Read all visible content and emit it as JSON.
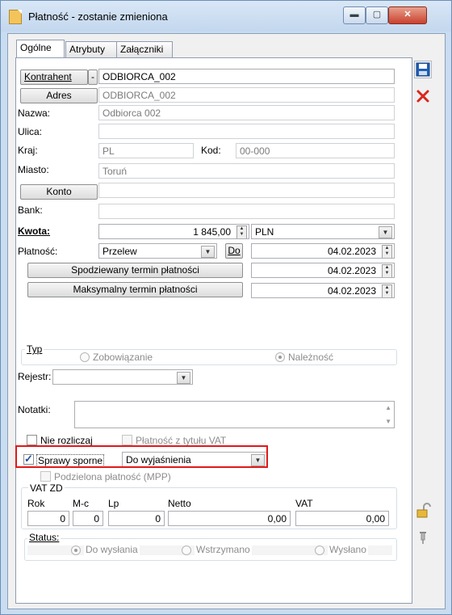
{
  "window": {
    "title": "Płatność - zostanie zmieniona"
  },
  "tabs": [
    "Ogólne",
    "Atrybuty",
    "Załączniki"
  ],
  "form": {
    "kontrahent_button": "Kontrahent",
    "kontrahent_value": "ODBIORCA_002",
    "adres_button": "Adres",
    "adres_value": "ODBIORCA_002",
    "nazwa_label": "Nazwa:",
    "nazwa_value": "Odbiorca 002",
    "ulica_label": "Ulica:",
    "ulica_value": "",
    "kraj_label": "Kraj:",
    "kraj_value": "PL",
    "kod_label": "Kod:",
    "kod_value": "00-000",
    "miasto_label": "Miasto:",
    "miasto_value": "Toruń",
    "konto_button": "Konto",
    "konto_value": "",
    "bank_label": "Bank:",
    "bank_value": "",
    "kwota_label": "Kwota:",
    "kwota_value": "1 845,00",
    "waluta_value": "PLN",
    "platnosc_label": "Płatność:",
    "platnosc_value": "Przelew",
    "do_button": "Do",
    "do_date": "04.02.2023",
    "spodziewany_button": "Spodziewany termin płatności",
    "spodziewany_date": "04.02.2023",
    "maksymalny_button": "Maksymalny termin płatności",
    "maksymalny_date": "04.02.2023"
  },
  "typ": {
    "label": "Typ",
    "option1": "Zobowiązanie",
    "option2": "Należność",
    "selected": "Należność"
  },
  "rejestr": {
    "label": "Rejestr:",
    "value": ""
  },
  "notatki": {
    "label": "Notatki:",
    "value": ""
  },
  "checks": {
    "nie_rozliczaj": "Nie rozliczaj",
    "platnosc_vat": "Płatność z tytułu VAT",
    "sprawy_sporne": "Sprawy sporne",
    "sprawy_sporne_value": "Do wyjaśnienia",
    "podzielona": "Podzielona płatność (MPP)"
  },
  "vatzd": {
    "title": "VAT ZD",
    "rok_label": "Rok",
    "mc_label": "M-c",
    "lp_label": "Lp",
    "netto_label": "Netto",
    "vat_label": "VAT",
    "rok": "0",
    "mc": "0",
    "lp": "0",
    "netto": "0,00",
    "vat": "0,00"
  },
  "status": {
    "label": "Status:",
    "option1": "Do wysłania",
    "option2": "Wstrzymano",
    "option3": "Wysłano",
    "selected": "Do wysłania"
  },
  "icons": {
    "save": "save-icon",
    "delete": "delete-icon",
    "lock": "lock-icon",
    "pin": "pin-icon"
  },
  "colors": {
    "highlight": "#e0191b",
    "save_blue": "#1f5fb8",
    "delete_red": "#d9261c"
  }
}
